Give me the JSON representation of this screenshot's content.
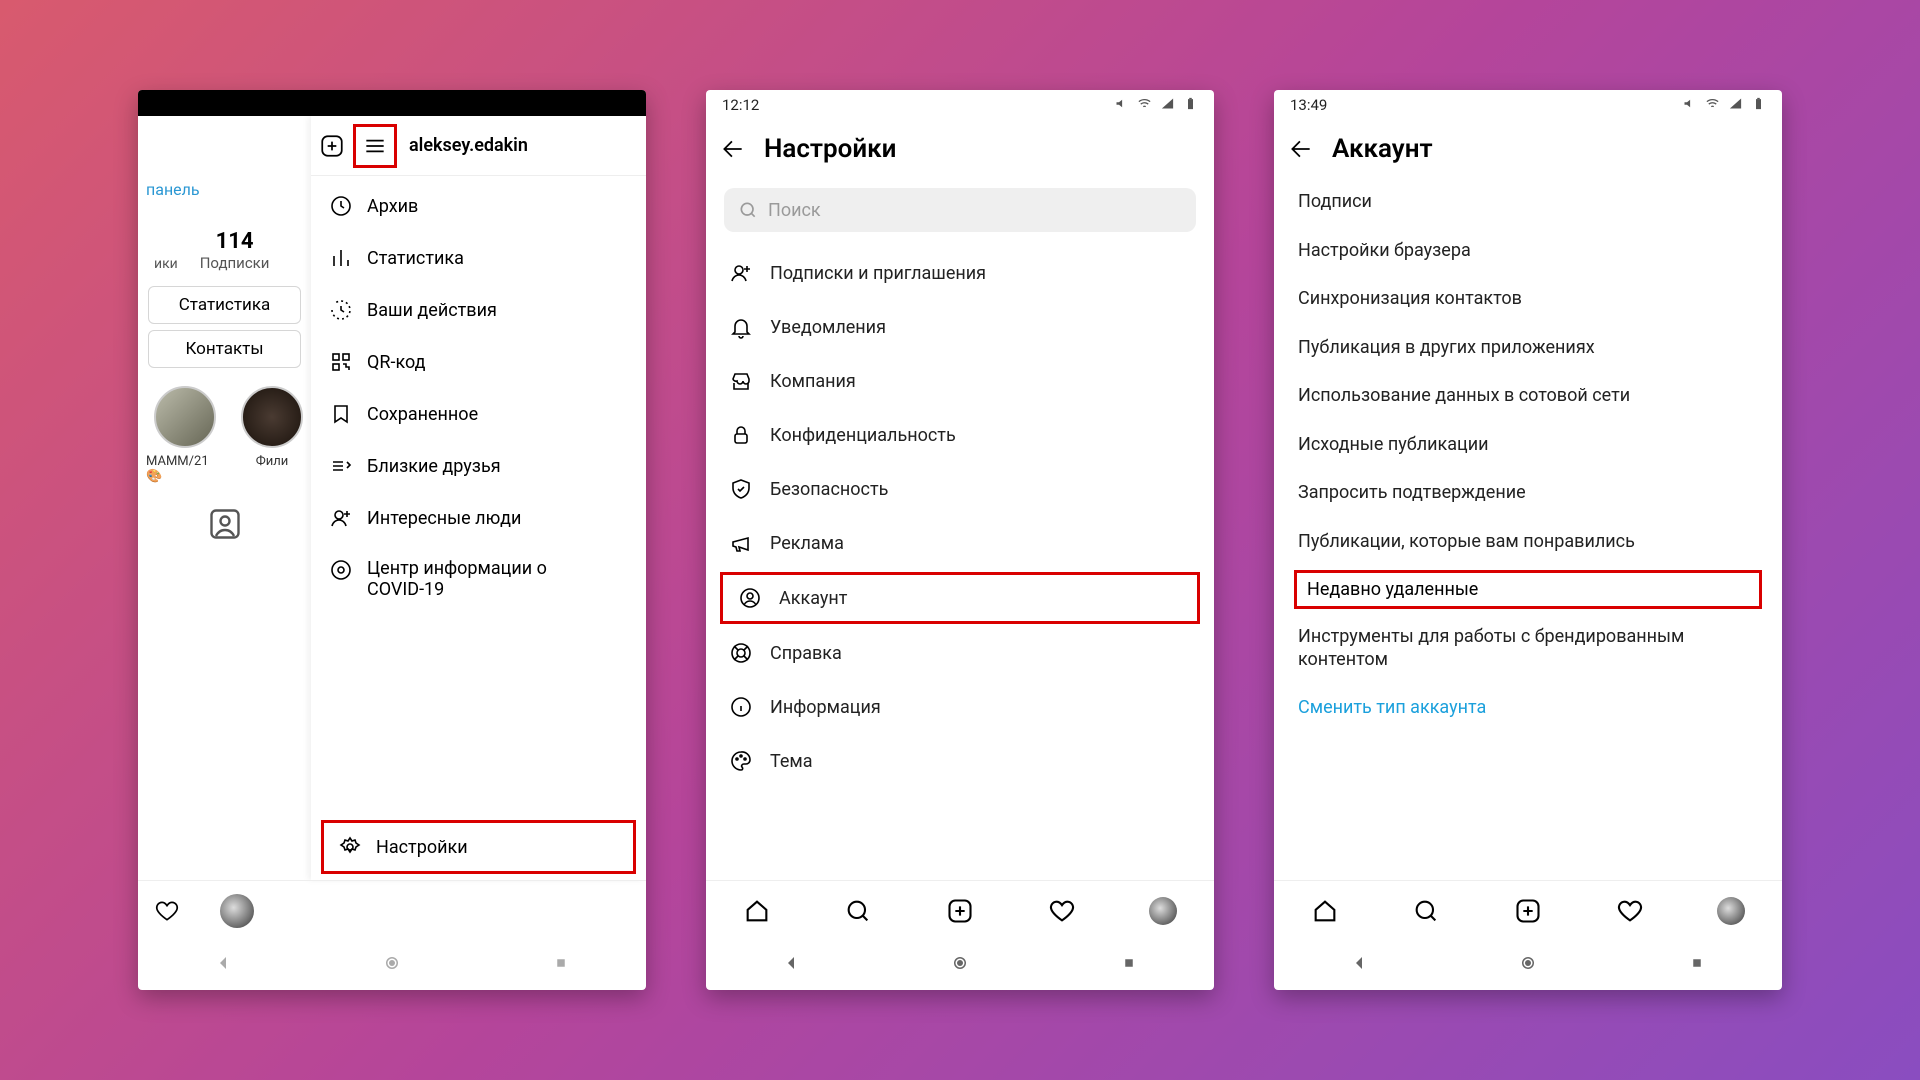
{
  "screen1": {
    "username": "aleksey.edakin",
    "panel_tab": "панель",
    "stats_count": "114",
    "stats_label": "Подписки",
    "stats_cut_label": "ики",
    "btn_statistics": "Статистика",
    "btn_contacts": "Контакты",
    "story1": "MAMM/21 🎨",
    "story2": "Фили",
    "side_items": [
      "Архив",
      "Статистика",
      "Ваши действия",
      "QR-код",
      "Сохраненное",
      "Близкие друзья",
      "Интересные люди"
    ],
    "covid_line1": "Центр информации о",
    "covid_line2": "COVID-19",
    "settings_label": "Настройки"
  },
  "screen2": {
    "time": "12:12",
    "title": "Настройки",
    "search_placeholder": "Поиск",
    "items": [
      "Подписки и приглашения",
      "Уведомления",
      "Компания",
      "Конфиденциальность",
      "Безопасность",
      "Реклама",
      "Аккаунт",
      "Справка",
      "Информация",
      "Тема"
    ]
  },
  "screen3": {
    "time": "13:49",
    "title": "Аккаунт",
    "items": [
      "Подписи",
      "Настройки браузера",
      "Синхронизация контактов",
      "Публикация в других приложениях",
      "Использование данных в сотовой сети",
      "Исходные публикации",
      "Запросить подтверждение",
      "Публикации, которые вам понравились"
    ],
    "highlight": "Недавно удаленные",
    "brand_tool": "Инструменты для работы с брендированным контентом",
    "switch_type": "Сменить тип аккаунта"
  }
}
